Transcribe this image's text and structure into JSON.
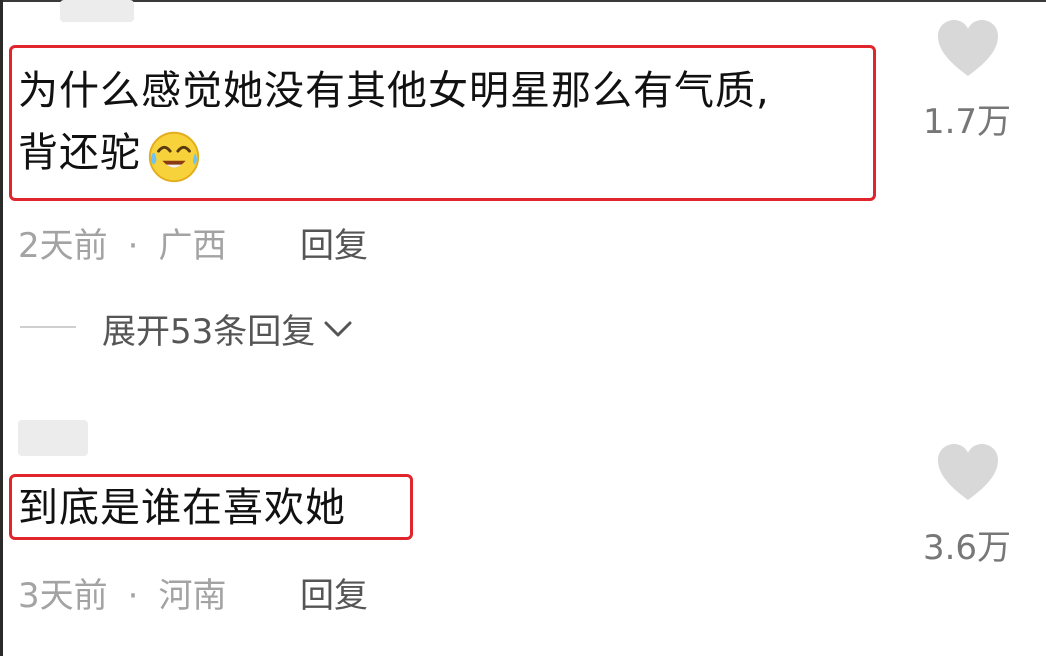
{
  "comments": [
    {
      "text_line1": "为什么感觉她没有其他女明星那么有气质,",
      "text_line2": "背还驼",
      "emoji": "crying-laughing-emoji",
      "time": "2天前",
      "separator": "·",
      "location": "广西",
      "reply_label": "回复",
      "like_count": "1.7万",
      "like_icon": "heart-icon"
    },
    {
      "text_line1": "到底是谁在喜欢她",
      "time": "3天前",
      "separator": "·",
      "location": "河南",
      "reply_label": "回复",
      "like_count": "3.6万",
      "like_icon": "heart-icon"
    }
  ],
  "expand_replies": {
    "label": "展开53条回复",
    "icon": "chevron-down-icon"
  },
  "colors": {
    "highlight_border": "#e0252c",
    "meta_text": "#a3a3a3",
    "heart_fill": "#d8d8d8"
  }
}
